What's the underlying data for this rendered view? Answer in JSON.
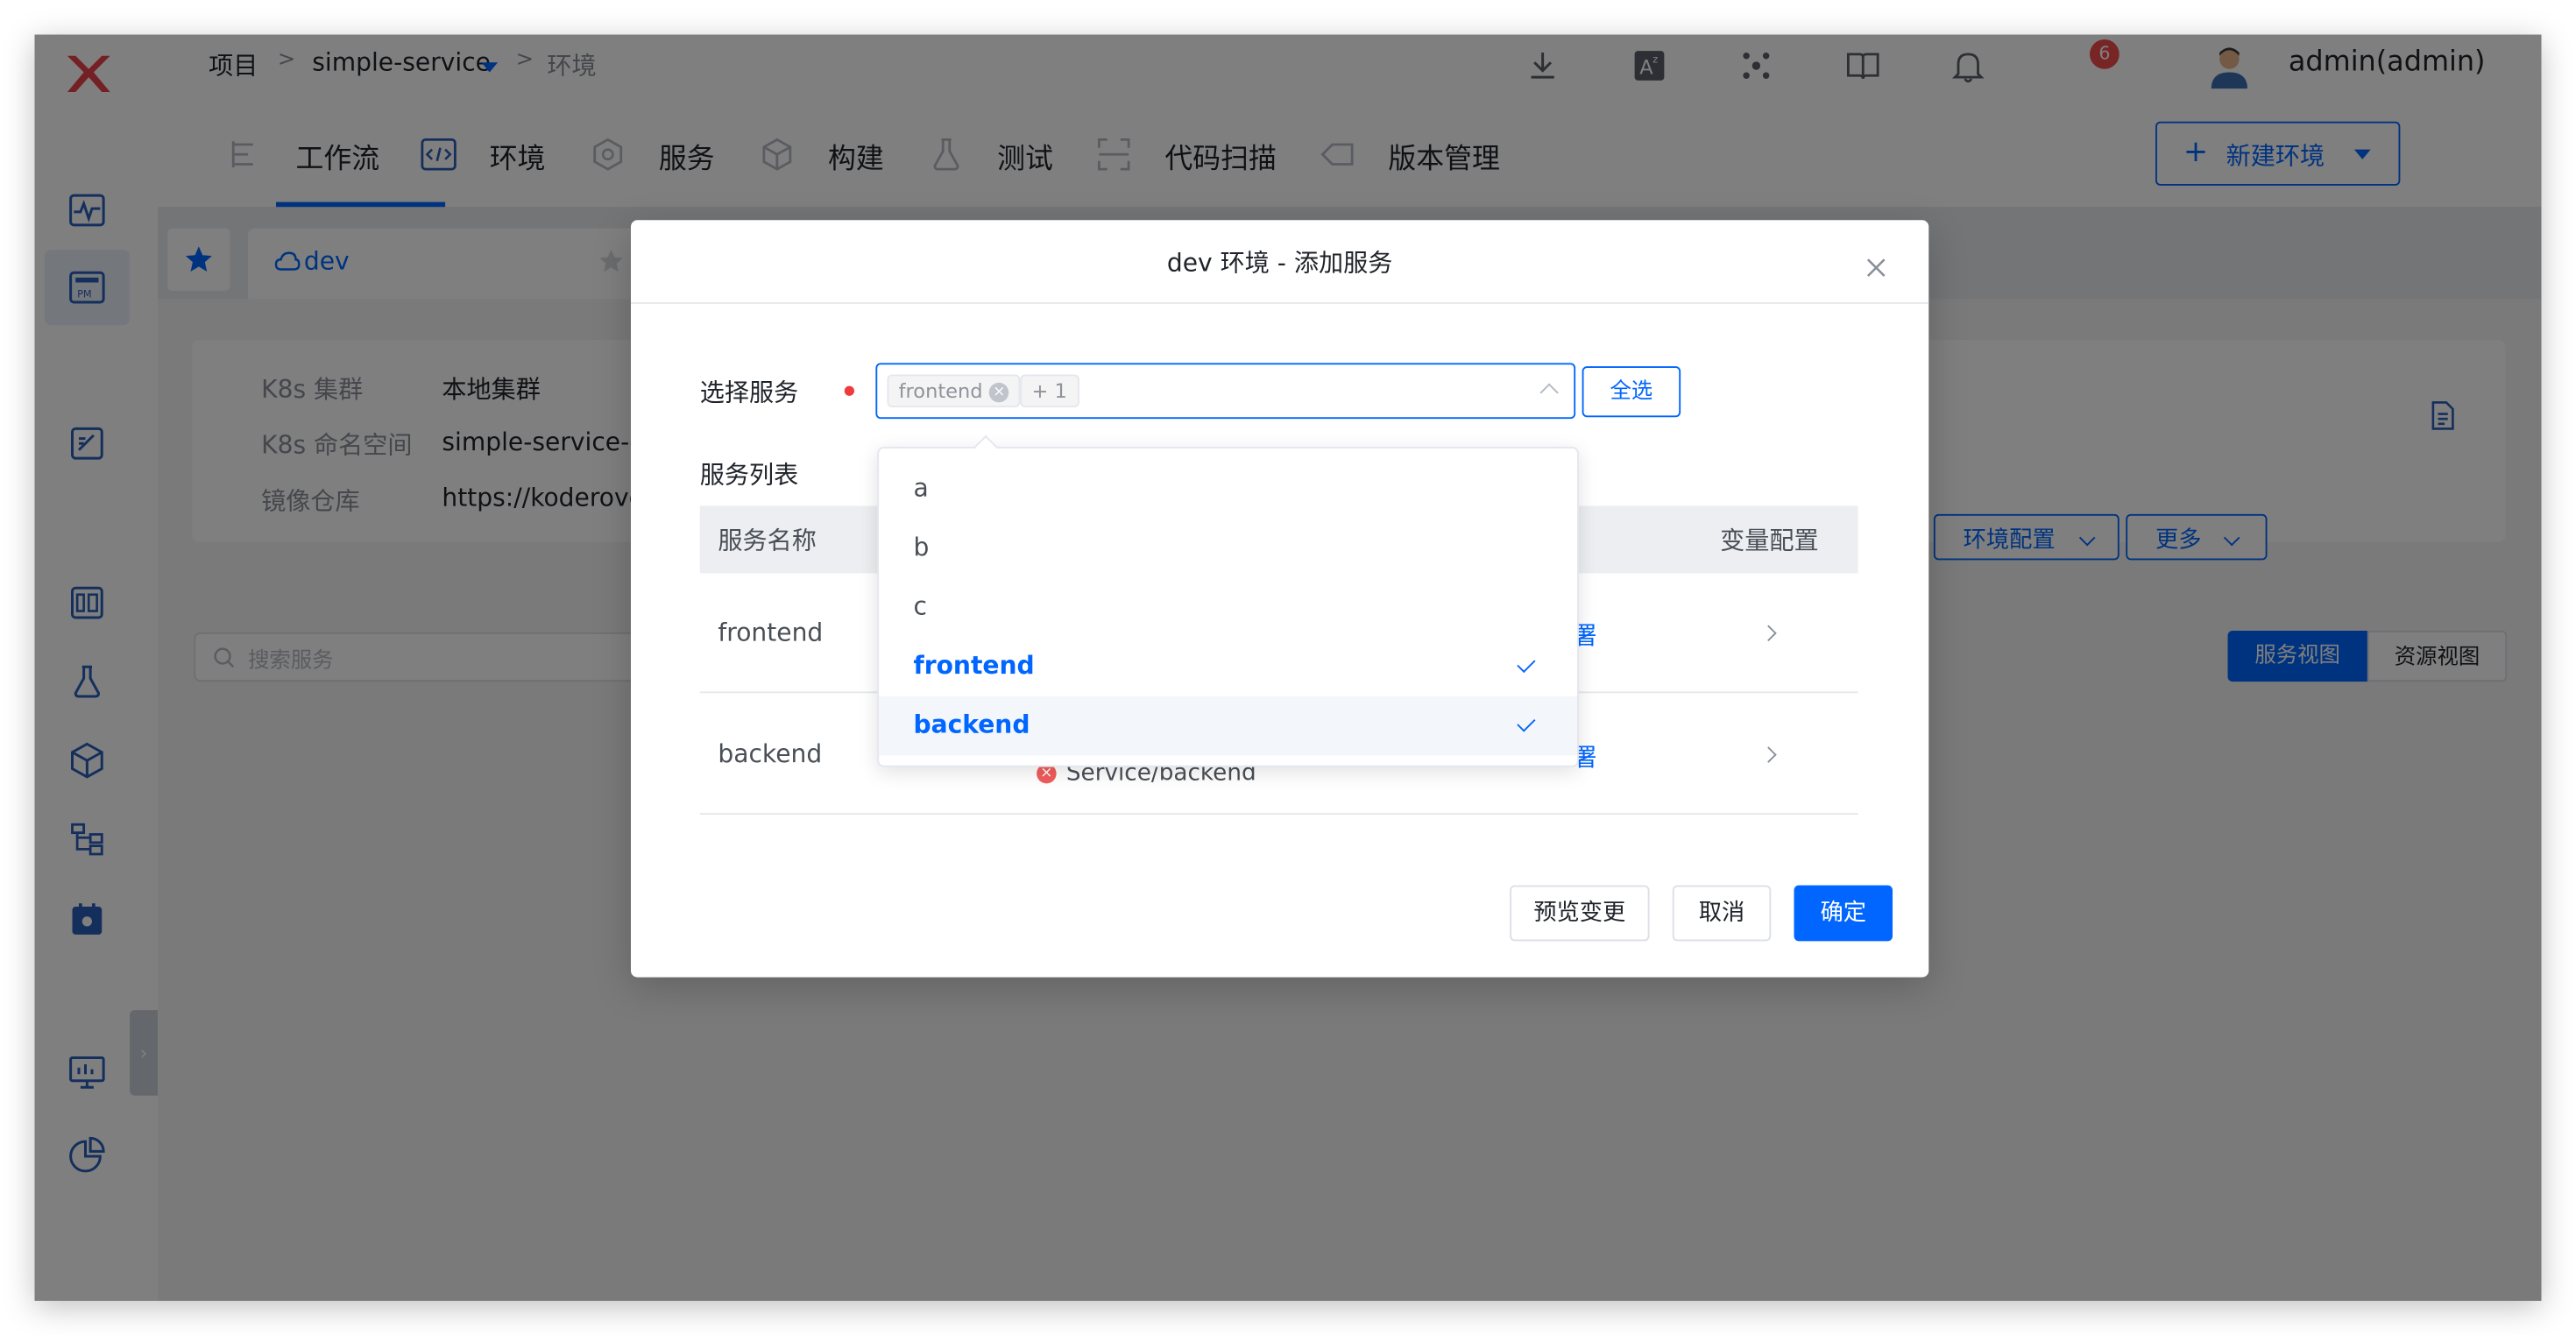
{
  "breadcrumb": {
    "root": "项目",
    "sep1": ">",
    "project": "simple-service",
    "sep2": ">",
    "current": "环境"
  },
  "header": {
    "user": "admin(admin)",
    "notification_count": "6"
  },
  "tabs": [
    {
      "label": "工作流",
      "icon": "workflow-icon"
    },
    {
      "label": "环境",
      "icon": "code-icon"
    },
    {
      "label": "服务",
      "icon": "service-icon"
    },
    {
      "label": "构建",
      "icon": "build-icon"
    },
    {
      "label": "测试",
      "icon": "flask-icon"
    },
    {
      "label": "代码扫描",
      "icon": "scan-icon"
    },
    {
      "label": "版本管理",
      "icon": "version-icon"
    }
  ],
  "new_env_button": "新建环境",
  "env_tab": {
    "name": "dev"
  },
  "env_info": [
    {
      "label": "K8s 集群",
      "value": "本地集群"
    },
    {
      "label": "K8s 命名空间",
      "value": "simple-service-er"
    },
    {
      "label": "镜像仓库",
      "value": "https://koderover"
    }
  ],
  "env_actions": {
    "config": "环境配置",
    "more": "更多"
  },
  "search": {
    "placeholder": "搜索服务"
  },
  "view_switch": {
    "service_view": "服务视图",
    "resource_view": "资源视图"
  },
  "dialog": {
    "title": "dev 环境 - 添加服务",
    "select_label": "选择服务",
    "selected_tag": "frontend",
    "extra_count": "+ 1",
    "select_all": "全选",
    "list_title": "服务列表",
    "columns": {
      "name": "服务名称",
      "vars": "变量配置"
    },
    "rows": [
      {
        "name": "frontend",
        "link": "署",
        "resource": ""
      },
      {
        "name": "backend",
        "link": "署",
        "resource": "Service/backend"
      }
    ],
    "buttons": {
      "preview": "预览变更",
      "cancel": "取消",
      "confirm": "确定"
    }
  },
  "dropdown_options": [
    {
      "label": "a",
      "selected": false
    },
    {
      "label": "b",
      "selected": false
    },
    {
      "label": "c",
      "selected": false
    },
    {
      "label": "frontend",
      "selected": true
    },
    {
      "label": "backend",
      "selected": true
    }
  ],
  "colors": {
    "accent": "#0066ff",
    "badge": "#ef4b4b",
    "overlay": "rgba(0,0,0,0.5)"
  }
}
